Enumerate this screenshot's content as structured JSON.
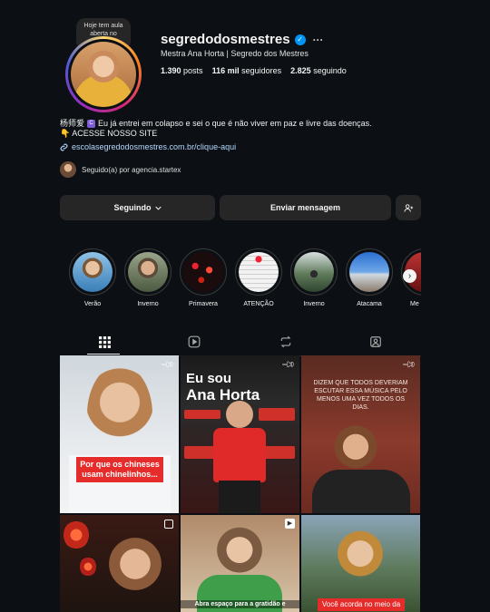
{
  "note": {
    "text": "Hoje tem aula aberta no YouTube..."
  },
  "profile": {
    "username": "segredodosmestres",
    "verified_icon": "✓",
    "more_icon": "···",
    "full_name": "Mestra Ana Horta | Segredo dos Mestres",
    "posts_count": "1.390",
    "posts_label": "posts",
    "followers_count": "116 mil",
    "followers_label": "seguidores",
    "following_count": "2.825",
    "following_label": "seguindo"
  },
  "bio": {
    "line1_prefix": "杨师爱",
    "line1_text": "Eu já entrei em colapso e sei o que é não viver em paz e livre das doenças.",
    "line2": "👇 ACESSE NOSSO SITE",
    "link": "escolasegredodosmestres.com.br/clique-aqui",
    "followed_by": "Seguido(a) por agencia.startex"
  },
  "buttons": {
    "following": "Seguindo",
    "message": "Enviar mensagem"
  },
  "highlights": [
    {
      "label": "Verão"
    },
    {
      "label": "Inverno"
    },
    {
      "label": "Primavera"
    },
    {
      "label": "ATENÇÃO"
    },
    {
      "label": "Inverno"
    },
    {
      "label": "Atacama"
    },
    {
      "label": "Me"
    }
  ],
  "posts": {
    "post1_caption": "Por que os chineses usam chinelinhos...",
    "post2_title_a": "Eu sou",
    "post2_title_b": "Ana Horta",
    "post3_caption": "DIZEM QUE TODOS DEVERIAM ESCUTAR ESSA MÚSICA PELO MENOS UMA VEZ TODOS OS DIAS.",
    "post5_caption": "Abra espaço para a gratidão e",
    "post6_caption": "Você acorda no meio da"
  },
  "colors": {
    "accent": "#0095f6",
    "background": "#0c1014",
    "button": "#262626"
  }
}
